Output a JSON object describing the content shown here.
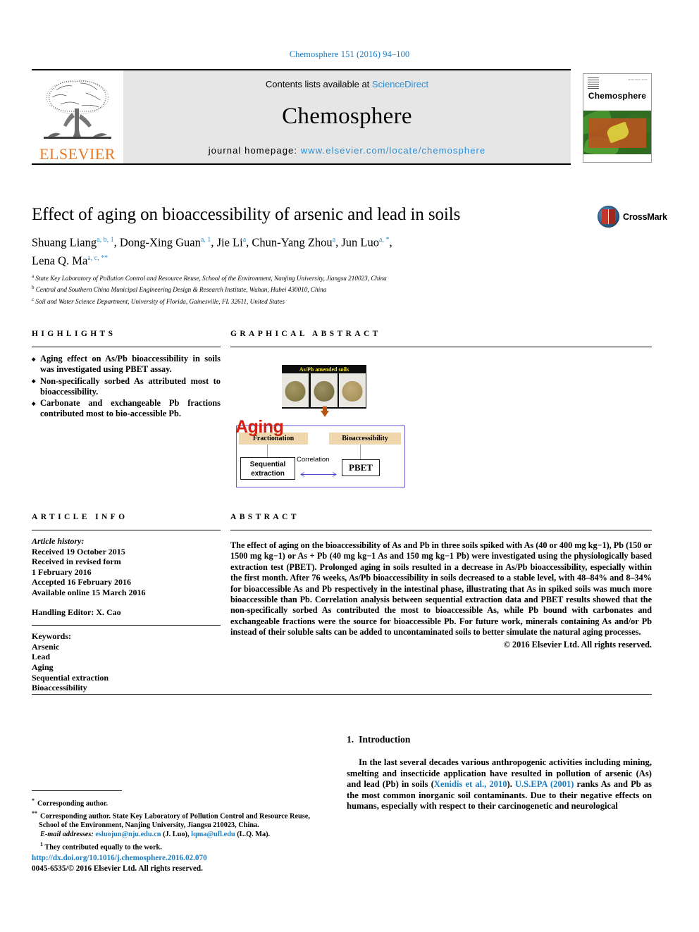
{
  "running_head": "Chemosphere 151 (2016) 94–100",
  "masthead": {
    "contents_prefix": "Contents lists available at",
    "sciencedirect": "ScienceDirect",
    "journal": "Chemosphere",
    "homepage_prefix": "journal homepage:",
    "homepage_url": "www.elsevier.com/locate/chemosphere",
    "publisher": "ELSEVIER",
    "cover_title": "Chemosphere"
  },
  "article": {
    "title": "Effect of aging on bioaccessibility of arsenic and lead in soils",
    "authors_line1_a": "Shuang Liang",
    "authors_line1_a_sup": "a, b, 1",
    "authors_line1_b": "Dong-Xing Guan",
    "authors_line1_b_sup": "a, 1",
    "authors_line1_c": "Jie Li",
    "authors_line1_c_sup": "a",
    "authors_line1_d": "Chun-Yang Zhou",
    "authors_line1_d_sup": "a",
    "authors_line1_e": "Jun Luo",
    "authors_line1_e_sup": "a, *",
    "authors_line2": "Lena Q. Ma",
    "authors_line2_sup": "a, c, **",
    "affiliations": [
      {
        "marker": "a",
        "text": "State Key Laboratory of Pollution Control and Resource Reuse, School of the Environment, Nanjing University, Jiangsu 210023, China"
      },
      {
        "marker": "b",
        "text": "Central and Southern China Municipal Engineering Design & Research Institute, Wuhan, Hubei 430010, China"
      },
      {
        "marker": "c",
        "text": "Soil and Water Science Department, University of Florida, Gainesville, FL 32611, United States"
      }
    ],
    "crossmark_label": "CrossMark"
  },
  "highlights": {
    "heading": "HIGHLIGHTS",
    "items": [
      "Aging effect on As/Pb bioaccessibility in soils was investigated using PBET assay.",
      "Non-specifically sorbed As attributed most to bioaccessibility.",
      "Carbonate and exchangeable Pb fractions contributed most to bio-accessible Pb."
    ]
  },
  "graphical_abstract": {
    "heading": "GRAPHICAL ABSTRACT",
    "photo_caption": "As/Pb amended soils",
    "aging_label": "Aging",
    "box_fractionation": "Fractionation",
    "box_bioaccessibility": "Bioaccessibility",
    "box_sequential_extraction": "Sequential extraction",
    "box_pbet": "PBET",
    "correlation_label": "Correlation"
  },
  "article_info": {
    "heading": "ARTICLE INFO",
    "history_label": "Article history:",
    "received": "Received 19 October 2015",
    "revised_label": "Received in revised form",
    "revised_date": "1 February 2016",
    "accepted": "Accepted 16 February 2016",
    "online": "Available online 15 March 2016",
    "handling_editor": "Handling Editor: X. Cao",
    "keywords_label": "Keywords:",
    "keywords": [
      "Arsenic",
      "Lead",
      "Aging",
      "Sequential extraction",
      "Bioaccessibility"
    ]
  },
  "abstract": {
    "heading": "ABSTRACT",
    "text": "The effect of aging on the bioaccessibility of As and Pb in three soils spiked with As (40 or 400 mg kg−1), Pb (150 or 1500 mg kg−1) or As + Pb (40 mg kg−1 As and 150 mg kg−1 Pb) were investigated using the physiologically based extraction test (PBET). Prolonged aging in soils resulted in a decrease in As/Pb bioaccessibility, especially within the first month. After 76 weeks, As/Pb bioaccessibility in soils decreased to a stable level, with 48–84% and 8–34% for bioaccessible As and Pb respectively in the intestinal phase, illustrating that As in spiked soils was much more bioaccessible than Pb. Correlation analysis between sequential extraction data and PBET results showed that the non-specifically sorbed As contributed the most to bioaccessible As, while Pb bound with carbonates and exchangeable fractions were the source for bioaccessible Pb. For future work, minerals containing As and/or Pb instead of their soluble salts can be added to uncontaminated soils to better simulate the natural aging processes.",
    "copyright": "© 2016 Elsevier Ltd. All rights reserved."
  },
  "introduction": {
    "number": "1.",
    "heading": "Introduction",
    "p1_part1": "In the last several decades various anthropogenic activities including mining, smelting and insecticide application have resulted in pollution of arsenic (As) and lead (Pb) in soils (",
    "p1_cite1": "Xenidis et al., 2010",
    "p1_part2": "). ",
    "p1_cite2": "U.S.EPA (2001)",
    "p1_part3": " ranks As and Pb as the most common inorganic soil contaminants. Due to their negative effects on humans, especially with respect to their carcinogenetic and neurological"
  },
  "footnotes": {
    "corr1_marker": "*",
    "corr1": "Corresponding author.",
    "corr2_marker": "**",
    "corr2": "Corresponding author. State Key Laboratory of Pollution Control and Resource Reuse, School of the Environment, Nanjing University, Jiangsu 210023, China.",
    "email_label": "E-mail addresses:",
    "email1": "esluojun@nju.edu.cn",
    "email1_name": "(J. Luo),",
    "email2": "lqma@ufl.edu",
    "email2_name": "(L.Q. Ma).",
    "equal_marker": "1",
    "equal_contrib": "They contributed equally to the work."
  },
  "footer": {
    "doi": "http://dx.doi.org/10.1016/j.chemosphere.2016.02.070",
    "issn_line": "0045-6535/© 2016 Elsevier Ltd. All rights reserved."
  },
  "colors": {
    "link_blue": "#1a7dc4",
    "elsevier_orange": "#e87722",
    "aging_red": "#d41f12",
    "box_tan": "#f0d6ad",
    "diagram_purple": "#6a5acd"
  }
}
